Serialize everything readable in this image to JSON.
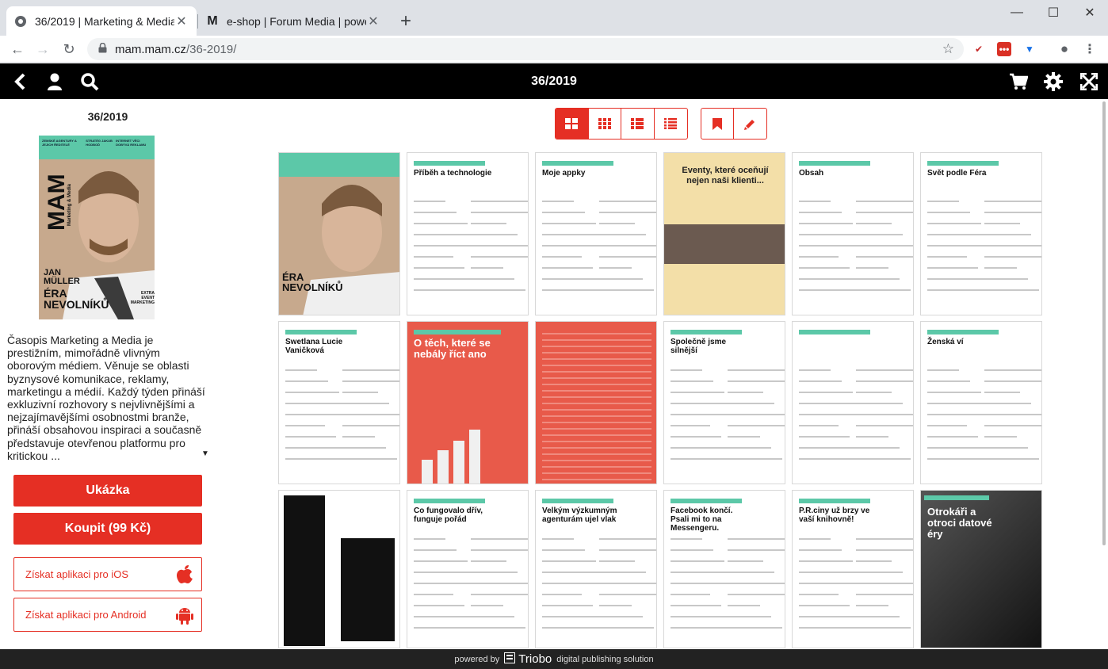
{
  "browser": {
    "tabs": [
      {
        "title": "36/2019 | Marketing & Media",
        "active": true
      },
      {
        "title": "e-shop | Forum Media | powered",
        "active": false
      }
    ],
    "url_host": "mam.mam.cz",
    "url_path": "/36-2019/"
  },
  "app": {
    "title": "36/2019"
  },
  "sidebar": {
    "issue_label": "36/2019",
    "cover": {
      "logo": "MAM",
      "logo_sub": "Marketing & Media",
      "name": "JAN MÜLLER",
      "headline": "ÉRA NEVOLNÍKŮ",
      "badge": "EXTRA EVENT MARKETING",
      "teasers": [
        "ZEMSKÉ AGENTURY A JEJICH ŘEDITELÉ",
        "STRATÉG JAKUB HODBOĎ",
        "INTERNET VĚCI DOBÝVÁ REKLAMU"
      ]
    },
    "description": "Časopis Marketing a Media je prestižním, mimořádně vlivným oborovým médiem. Věnuje se oblasti byznysové komunikace, reklamy, marketingu a médií. Každý týden přináší exkluzivní rozhovory s nejvlivnějšími a nejzajímavějšími osobnostmi branže, přináší obsahovou inspiraci a současně představuje otevřenou platformu pro kritickou ...",
    "preview_button": "Ukázka",
    "buy_button": "Koupit (99 Kč)",
    "ios_button": "Získat aplikaci pro iOS",
    "android_button": "Získat aplikaci pro Android"
  },
  "pages": [
    {
      "kind": "cover",
      "heading": ""
    },
    {
      "kind": "article",
      "heading": "Příběh a technologie"
    },
    {
      "kind": "apps",
      "heading": "Moje appky"
    },
    {
      "kind": "event",
      "heading": "Eventy, které oceňují nejen naši klienti..."
    },
    {
      "kind": "contents",
      "heading": "Obsah"
    },
    {
      "kind": "article",
      "heading": "Svět podle Féra"
    },
    {
      "kind": "article",
      "heading": "Swetlana Lucie Vaničková"
    },
    {
      "kind": "red",
      "heading": "O těch, které se nebály říct ano"
    },
    {
      "kind": "redtext",
      "heading": ""
    },
    {
      "kind": "article",
      "heading": "Společně jsme silnější"
    },
    {
      "kind": "article",
      "heading": ""
    },
    {
      "kind": "article",
      "heading": "Ženská ví"
    },
    {
      "kind": "agency",
      "heading": ""
    },
    {
      "kind": "article",
      "heading": "Co fungovalo dřív, funguje pořád"
    },
    {
      "kind": "article",
      "heading": "Velkým výzkumným agenturám ujel vlak"
    },
    {
      "kind": "article",
      "heading": "Facebook končí. Psali mi to na Messengeru."
    },
    {
      "kind": "article",
      "heading": "P.R.ciny už brzy ve vaší knihovně!"
    },
    {
      "kind": "photo",
      "heading": "Otrokáři a otroci datové éry"
    }
  ],
  "footer": {
    "powered": "powered by",
    "brand": "Triobo",
    "tagline": "digital publishing solution"
  },
  "colors": {
    "accent": "#e52f24",
    "header_bg": "#000000",
    "cover_teal": "#5cc8a8"
  }
}
